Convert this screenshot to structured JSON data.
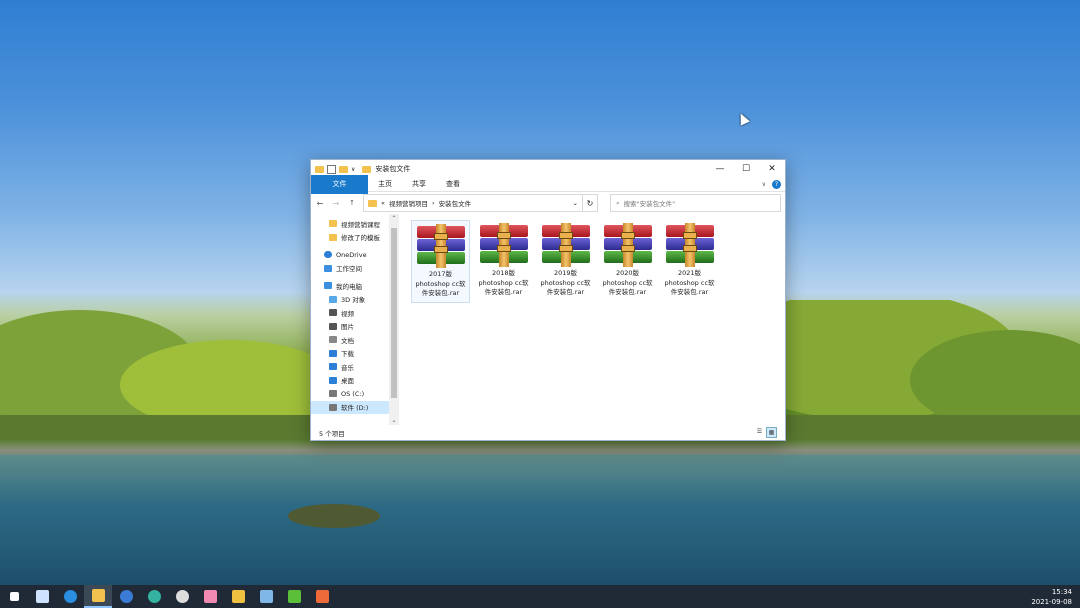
{
  "window": {
    "title": "安装包文件",
    "ribbon_tabs": [
      "文件",
      "主页",
      "共享",
      "查看"
    ],
    "help_label": "?",
    "controls": {
      "minimize": "—",
      "maximize": "☐",
      "close": "✕"
    }
  },
  "address": {
    "back": "←",
    "forward": "→",
    "up": "↑",
    "overflow": "«",
    "crumbs": [
      "视频营销项目",
      "安装包文件"
    ],
    "separator": "›",
    "dropdown": "⌄",
    "refresh": "↻",
    "search_placeholder": "搜索\"安装包文件\""
  },
  "sidebar": {
    "items": [
      {
        "label": "视频营销课程",
        "icon": "folder-icon",
        "indent": 1
      },
      {
        "label": "修改了的模板",
        "icon": "folder-icon",
        "indent": 1
      },
      {
        "label": "OneDrive",
        "icon": "cloud-icon",
        "indent": 0
      },
      {
        "label": "工作空间",
        "icon": "workspace-icon",
        "indent": 0
      },
      {
        "label": "我的电脑",
        "icon": "computer-icon",
        "indent": 0
      },
      {
        "label": "3D 对象",
        "icon": "3d-objects-icon",
        "indent": 1
      },
      {
        "label": "视频",
        "icon": "video-icon",
        "indent": 1
      },
      {
        "label": "图片",
        "icon": "pictures-icon",
        "indent": 1
      },
      {
        "label": "文档",
        "icon": "documents-icon",
        "indent": 1
      },
      {
        "label": "下载",
        "icon": "downloads-icon",
        "indent": 1
      },
      {
        "label": "音乐",
        "icon": "music-icon",
        "indent": 1
      },
      {
        "label": "桌面",
        "icon": "desktop-icon",
        "indent": 1
      },
      {
        "label": "OS (C:)",
        "icon": "drive-icon",
        "indent": 1
      },
      {
        "label": "软件 (D:)",
        "icon": "drive-icon",
        "indent": 1,
        "selected": true
      }
    ]
  },
  "files": [
    {
      "line1": "2017版",
      "line2": "photoshop cc软",
      "line3": "件安装包.rar",
      "selected": true
    },
    {
      "line1": "2018版",
      "line2": "photoshop cc软",
      "line3": "件安装包.rar"
    },
    {
      "line1": "2019版",
      "line2": "photoshop cc软",
      "line3": "件安装包.rar"
    },
    {
      "line1": "2020版",
      "line2": "photoshop cc软",
      "line3": "件安装包.rar"
    },
    {
      "line1": "2021版",
      "line2": "photoshop cc软",
      "line3": "件安装包.rar"
    }
  ],
  "status": {
    "item_count": "5 个项目"
  },
  "taskbar": {
    "apps": [
      {
        "name": "start",
        "color": "#ffffff"
      },
      {
        "name": "task-view",
        "color": "#cfe3ff"
      },
      {
        "name": "browser",
        "color": "#2b8de0"
      },
      {
        "name": "file-explorer",
        "color": "#f2c14e",
        "active": true
      },
      {
        "name": "app-sphere",
        "color": "#3a7bd5"
      },
      {
        "name": "edge",
        "color": "#34b3a0"
      },
      {
        "name": "dell",
        "color": "#dddddd"
      },
      {
        "name": "app-pink",
        "color": "#f08ab0"
      },
      {
        "name": "app-yellow",
        "color": "#f0c040"
      },
      {
        "name": "app-blue",
        "color": "#7fb8e8"
      },
      {
        "name": "camtasia",
        "color": "#5bbf3a"
      },
      {
        "name": "app-orange",
        "color": "#ef6a3a"
      }
    ],
    "time": "15:34",
    "date": "2021-09-08"
  }
}
